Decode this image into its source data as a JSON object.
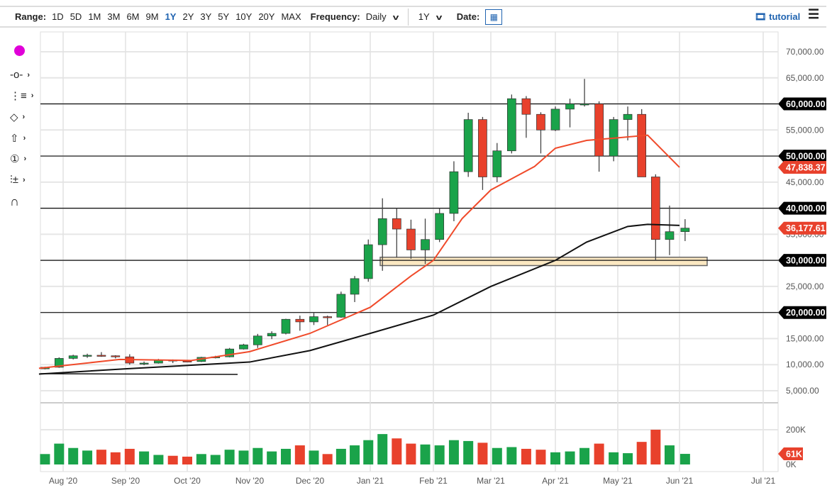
{
  "toolbar": {
    "range_label": "Range:",
    "ranges": [
      "1D",
      "5D",
      "1M",
      "3M",
      "6M",
      "9M",
      "1Y",
      "2Y",
      "3Y",
      "5Y",
      "10Y",
      "20Y",
      "MAX"
    ],
    "active_range": "1Y",
    "frequency_label": "Frequency:",
    "frequency": "Daily",
    "period": "1Y",
    "date_label": "Date:",
    "tutorial": "tutorial"
  },
  "tools": [
    "color-picker",
    "line",
    "fib",
    "ellipse",
    "arrow",
    "counter",
    "pitchfork",
    "magnet"
  ],
  "colors": {
    "up": "#1aa34a",
    "down": "#e8412c",
    "ma50": "#f04a2a",
    "ma200": "#111111",
    "tool_dot": "#e000d8",
    "zone": "#fbe8c2"
  },
  "chart_data": {
    "type": "candlestick",
    "frequency_note": "approximate weekly OHLC (USD) read from daily chart",
    "weeks_start": [
      "Jul 20",
      "Jul 27",
      "Aug 3",
      "Aug 10",
      "Aug 17",
      "Aug 24",
      "Aug 31",
      "Sep 7",
      "Sep 14",
      "Sep 21",
      "Sep 28",
      "Oct 5",
      "Oct 12",
      "Oct 19",
      "Oct 26",
      "Nov 2",
      "Nov 9",
      "Nov 16",
      "Nov 23",
      "Nov 30",
      "Dec 7",
      "Dec 14",
      "Dec 21",
      "Dec 28",
      "Jan 4",
      "Jan 11",
      "Jan 18",
      "Jan 25",
      "Feb 1",
      "Feb 8",
      "Feb 15",
      "Feb 22",
      "Mar 1",
      "Mar 8",
      "Mar 15",
      "Mar 22",
      "Mar 29",
      "Apr 5",
      "Apr 12",
      "Apr 19",
      "Apr 26",
      "May 3",
      "May 10",
      "May 17",
      "May 24",
      "May 31"
    ],
    "ohlc": [
      [
        9200,
        9600,
        9100,
        9500
      ],
      [
        9500,
        11400,
        9400,
        11200
      ],
      [
        11200,
        11900,
        11000,
        11700
      ],
      [
        11700,
        12100,
        11300,
        11800
      ],
      [
        11800,
        12400,
        11500,
        11700
      ],
      [
        11700,
        11800,
        11200,
        11500
      ],
      [
        11500,
        12000,
        10000,
        10300
      ],
      [
        10300,
        10600,
        9900,
        10300
      ],
      [
        10300,
        11100,
        10200,
        10900
      ],
      [
        10900,
        11000,
        10300,
        10700
      ],
      [
        10700,
        10900,
        10500,
        10600
      ],
      [
        10600,
        11500,
        10500,
        11400
      ],
      [
        11400,
        11700,
        11200,
        11500
      ],
      [
        11500,
        13200,
        11400,
        13000
      ],
      [
        13000,
        14000,
        12900,
        13800
      ],
      [
        13800,
        15900,
        13200,
        15500
      ],
      [
        15500,
        16400,
        14900,
        16000
      ],
      [
        16000,
        18800,
        15800,
        18700
      ],
      [
        18700,
        19400,
        16500,
        18200
      ],
      [
        18200,
        19900,
        17600,
        19200
      ],
      [
        19200,
        19400,
        17600,
        19100
      ],
      [
        19100,
        24000,
        19000,
        23500
      ],
      [
        23500,
        27000,
        22000,
        26500
      ],
      [
        26500,
        34000,
        25900,
        33000
      ],
      [
        33000,
        41900,
        28000,
        38000
      ],
      [
        38000,
        40000,
        30500,
        36000
      ],
      [
        36000,
        37800,
        30300,
        32000
      ],
      [
        32000,
        38000,
        29300,
        34000
      ],
      [
        34000,
        40000,
        33500,
        39000
      ],
      [
        39000,
        49000,
        37500,
        47000
      ],
      [
        47000,
        58300,
        46000,
        57000
      ],
      [
        57000,
        57500,
        43500,
        46000
      ],
      [
        46000,
        52500,
        45000,
        51000
      ],
      [
        51000,
        61800,
        50500,
        61000
      ],
      [
        61000,
        61500,
        53500,
        58000
      ],
      [
        58000,
        58400,
        50500,
        55000
      ],
      [
        55000,
        59500,
        54800,
        59000
      ],
      [
        59000,
        61000,
        55500,
        60000
      ],
      [
        60000,
        64800,
        59500,
        60000
      ],
      [
        60000,
        60500,
        47000,
        50000
      ],
      [
        50000,
        57500,
        49000,
        57000
      ],
      [
        57000,
        59500,
        53000,
        58000
      ],
      [
        58000,
        59000,
        46000,
        46000
      ],
      [
        46000,
        46500,
        30000,
        34000
      ],
      [
        34000,
        40500,
        31000,
        35500
      ],
      [
        35500,
        37900,
        33700,
        36177
      ]
    ],
    "volume_k": [
      60,
      120,
      95,
      80,
      85,
      70,
      90,
      75,
      55,
      50,
      45,
      60,
      55,
      85,
      80,
      95,
      75,
      90,
      110,
      80,
      60,
      90,
      110,
      140,
      175,
      150,
      120,
      115,
      110,
      140,
      135,
      125,
      95,
      100,
      90,
      85,
      70,
      75,
      95,
      120,
      70,
      65,
      130,
      200,
      110,
      61
    ],
    "ma50": {
      "days": [
        0,
        40,
        75,
        104,
        134,
        165,
        185,
        196,
        210,
        224,
        245,
        255,
        270,
        285,
        300,
        316
      ],
      "values": [
        9300,
        11000,
        10800,
        12500,
        16000,
        21000,
        27000,
        30000,
        38000,
        43500,
        48000,
        51500,
        53000,
        53500,
        54000,
        47838
      ]
    },
    "ma200": {
      "days": [
        0,
        43,
        104,
        134,
        165,
        196,
        224,
        255,
        270,
        290,
        300,
        316
      ],
      "values": [
        8200,
        9200,
        10500,
        12700,
        16000,
        19500,
        25000,
        30000,
        33500,
        36500,
        36900,
        36700
      ]
    },
    "horizontal_levels": [
      60000,
      50000,
      40000,
      30000,
      20000
    ],
    "support_zone": {
      "from": 29000,
      "to": 30600,
      "start": "Jan '21",
      "end": "Jun '21"
    },
    "trend_line": {
      "value": 8000,
      "start": "Jul '20",
      "end": "Oct '20"
    },
    "ylim": [
      3000,
      73000
    ],
    "y_ticks": [
      "5,000.00",
      "10,000.00",
      "15,000.00",
      "20,000.00",
      "25,000.00",
      "30,000.00",
      "35,000.00",
      "40,000.00",
      "45,000.00",
      "50,000.00",
      "55,000.00",
      "60,000.00",
      "65,000.00",
      "70,000.00"
    ],
    "level_labels": [
      "60,000.00",
      "50,000.00",
      "40,000.00",
      "30,000.00",
      "20,000.00"
    ],
    "ma50_label": "47,838.37",
    "last_price_label": "36,177.61",
    "volume_ticks": [
      "0K",
      "200K"
    ],
    "last_volume_label": "61K",
    "x_ticks": [
      "Aug '20",
      "Sep '20",
      "Oct '20",
      "Nov '20",
      "Dec '20",
      "Jan '21",
      "Feb '21",
      "Mar '21",
      "Apr '21",
      "May '21",
      "Jun '21",
      "Jul '21"
    ]
  }
}
